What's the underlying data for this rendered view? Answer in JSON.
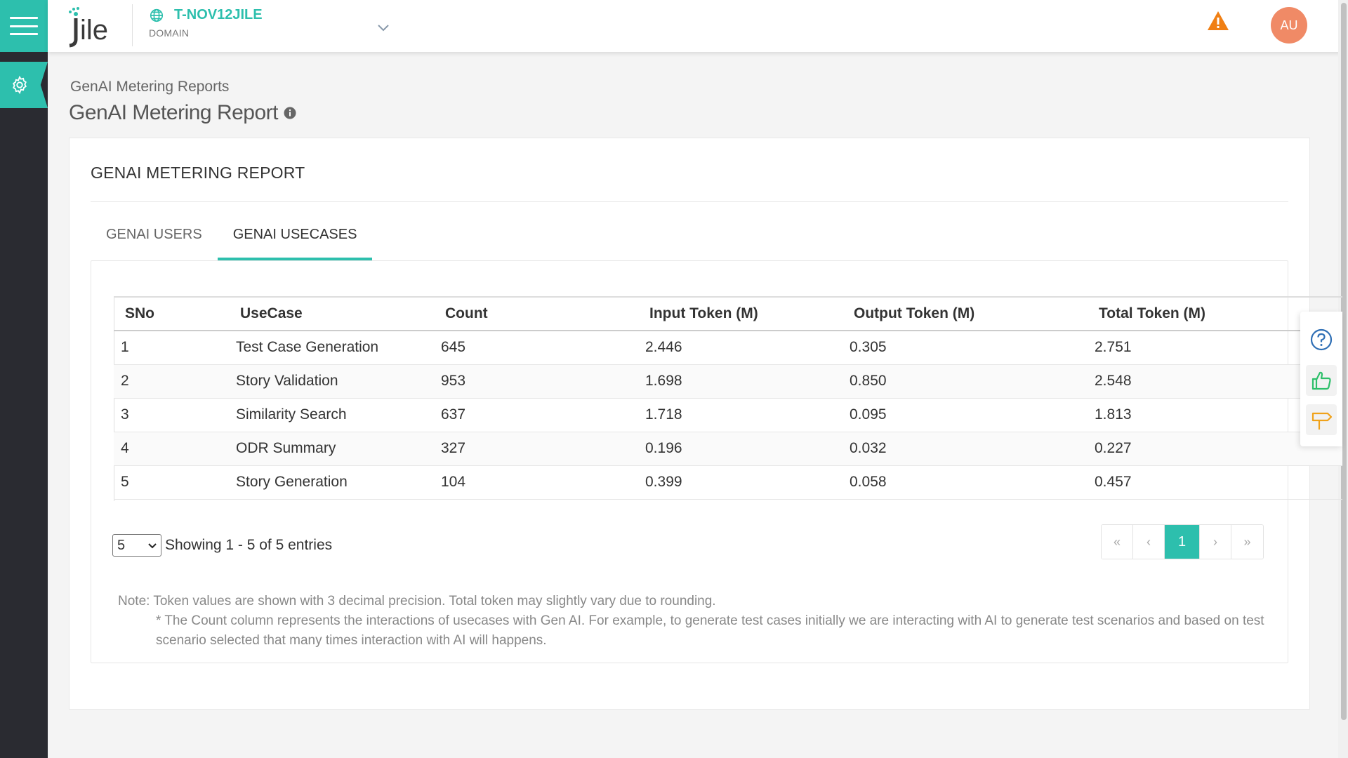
{
  "header": {
    "domain_name": "T-NOV12JILE",
    "domain_label": "DOMAIN",
    "avatar_initials": "AU"
  },
  "breadcrumb": "GenAI Metering Reports",
  "page_title": "GenAI Metering Report",
  "card": {
    "title": "GENAI METERING REPORT",
    "tabs": [
      {
        "label": "GENAI USERS",
        "active": false
      },
      {
        "label": "GENAI USECASES",
        "active": true
      }
    ]
  },
  "table": {
    "columns": [
      "SNo",
      "UseCase",
      "Count",
      "Input Token (M)",
      "Output Token (M)",
      "Total Token (M)"
    ],
    "rows": [
      [
        "1",
        "Test Case Generation",
        "645",
        "2.446",
        "0.305",
        "2.751"
      ],
      [
        "2",
        "Story Validation",
        "953",
        "1.698",
        "0.850",
        "2.548"
      ],
      [
        "3",
        "Similarity Search",
        "637",
        "1.718",
        "0.095",
        "1.813"
      ],
      [
        "4",
        "ODR Summary",
        "327",
        "0.196",
        "0.032",
        "0.227"
      ],
      [
        "5",
        "Story Generation",
        "104",
        "0.399",
        "0.058",
        "0.457"
      ]
    ]
  },
  "pagination": {
    "page_size": "5",
    "showing_text": "Showing 1 - 5 of 5 entries",
    "first": "«",
    "prev": "‹",
    "current": "1",
    "next": "›",
    "last": "»"
  },
  "notes": {
    "line1": "Note: Token values are shown with 3 decimal precision. Total token may slightly vary due to rounding.",
    "line2": "* The Count column represents the interactions of usecases with Gen AI. For example, to generate test cases initially we are interacting with AI to generate test scenarios and based on test scenario selected that many times interaction with AI will happens."
  },
  "colors": {
    "accent": "#2dbfad",
    "sidebar": "#2a2b31",
    "warning": "#f07f14",
    "avatar": "#f08a66"
  },
  "icons": [
    "menu-icon",
    "gear-icon",
    "globe-icon",
    "chevron-down-icon",
    "warning-icon",
    "info-icon",
    "help-icon",
    "thumbs-up-icon",
    "signpost-icon"
  ]
}
